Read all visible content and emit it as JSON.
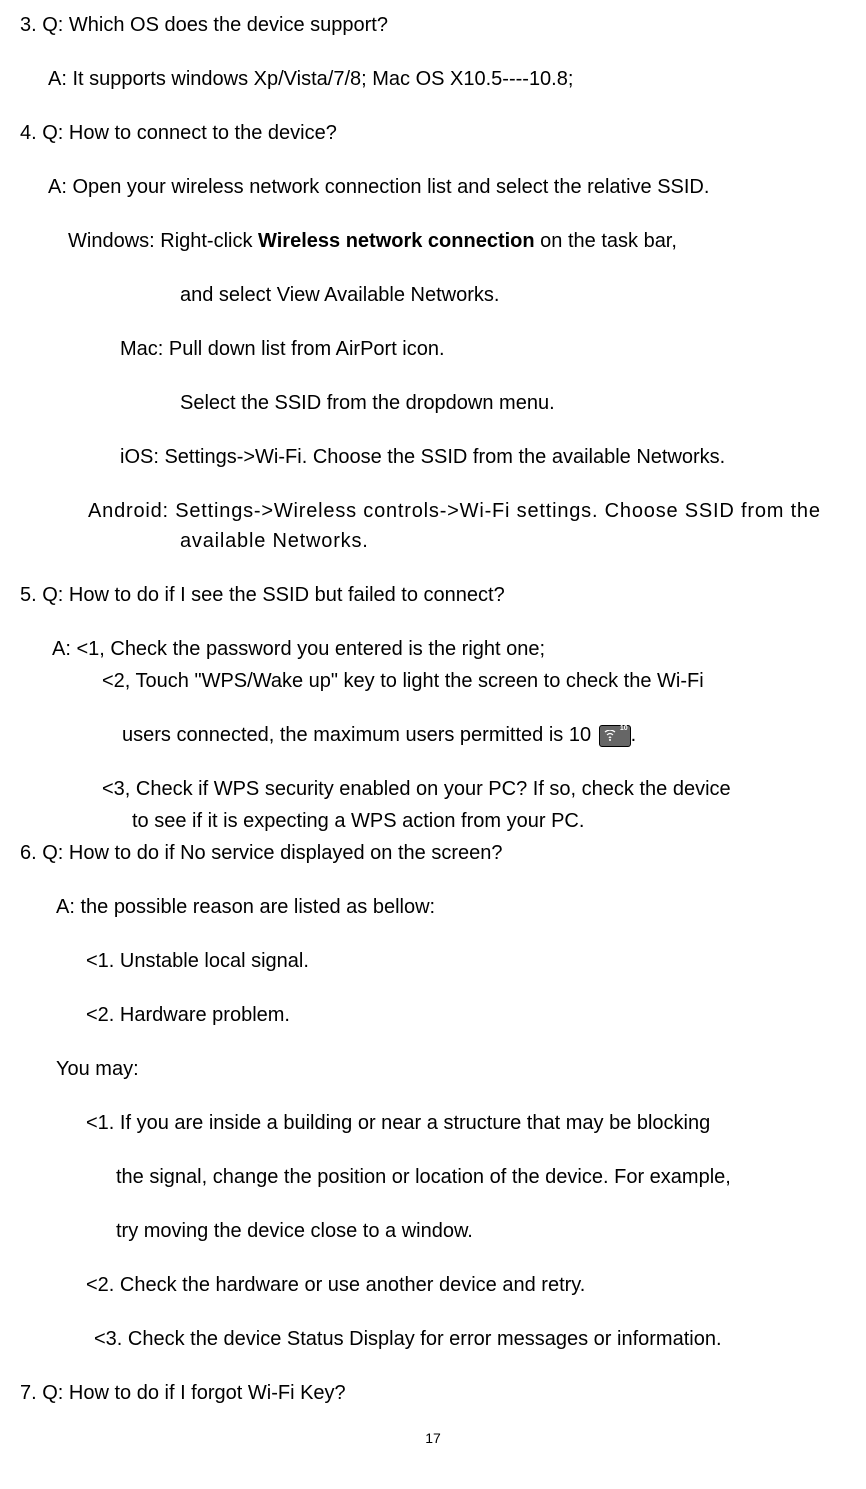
{
  "q3": {
    "question": "3. Q:    Which OS does the device support?",
    "answer": "A:    It supports windows Xp/Vista/7/8; Mac OS X10.5----10.8;"
  },
  "q4": {
    "question": "4. Q: How to connect to the device?",
    "answer_intro": "A: Open your wireless network connection list and select the relative SSID.",
    "windows_1a": "Windows: Right-click ",
    "windows_bold": "Wireless network connection",
    "windows_1b": " on the task bar,",
    "windows_2": "and select View Available Networks.",
    "mac_1": "Mac:    Pull down list from AirPort icon.",
    "mac_2": "Select the SSID from the dropdown menu.",
    "ios": "iOS:    Settings->Wi-Fi. Choose the SSID from the available Networks.",
    "android": "Android:  Settings->Wireless  controls->Wi-Fi  settings.  Choose  SSID  from  the available Networks."
  },
  "q5": {
    "question": "5.    Q: How to do if I see the SSID but failed to connect?",
    "a1": "A:    <1, Check the password you entered is the right one;",
    "a2": "<2, Touch \"WPS/Wake up\" key to light the screen to check the Wi-Fi",
    "a2b": "users connected, the maximum users permitted is 10  ",
    "a2c": ".",
    "a3_1": "<3, Check if WPS security enabled on your PC? If so, check the device",
    "a3_2": "to see if it is expecting a WPS action from your PC."
  },
  "q6": {
    "question": "6.    Q: How to do if No service displayed on the screen?",
    "answer_intro": "A: the possible reason are listed as bellow:",
    "r1": "<1. Unstable local signal.",
    "r2": "<2. Hardware problem.",
    "youmay": "You may:",
    "m1_1": "<1. If you are inside a building or near a structure that may be blocking",
    "m1_2": "the signal, change the position or location of the device. For example,",
    "m1_3": "try moving the device close to a window.",
    "m2": "<2. Check the hardware or use another device and retry.",
    "m3": "<3. Check the device Status Display for error messages or information."
  },
  "q7": {
    "question": "7.    Q: How to do if I forgot Wi-Fi Key?"
  },
  "page_number": "17"
}
